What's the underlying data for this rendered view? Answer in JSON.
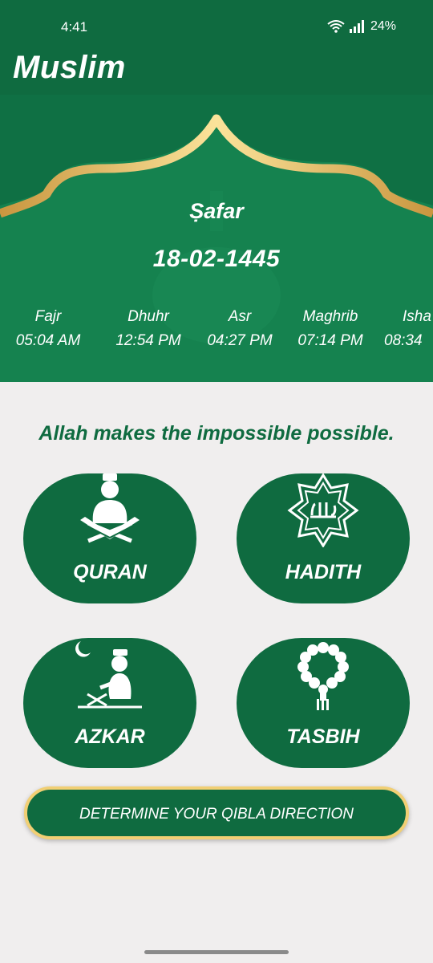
{
  "status": {
    "time": "4:41",
    "battery": "24%"
  },
  "app": {
    "title": "Muslim"
  },
  "banner": {
    "month": "Ṣafar",
    "date": "18-02-1445",
    "prayers": [
      {
        "name": "Fajr",
        "time": "05:04 AM"
      },
      {
        "name": "Dhuhr",
        "time": "12:54 PM"
      },
      {
        "name": "Asr",
        "time": "04:27 PM"
      },
      {
        "name": "Maghrib",
        "time": "07:14 PM"
      },
      {
        "name": "Isha",
        "time": "08:34"
      }
    ]
  },
  "quote": "Allah makes the impossible possible.",
  "tiles": [
    {
      "label": "QURAN",
      "icon": "quran-reader-icon"
    },
    {
      "label": "HADITH",
      "icon": "hadith-star-icon"
    },
    {
      "label": "AZKAR",
      "icon": "praying-man-icon"
    },
    {
      "label": "TASBIH",
      "icon": "prayer-beads-icon"
    }
  ],
  "qibla_button": "DETERMINE YOUR QIBLA DIRECTION",
  "colors": {
    "primary": "#0f6b40",
    "banner": "#15824f",
    "gold": "#f1cf74",
    "background": "#f0eeee"
  }
}
